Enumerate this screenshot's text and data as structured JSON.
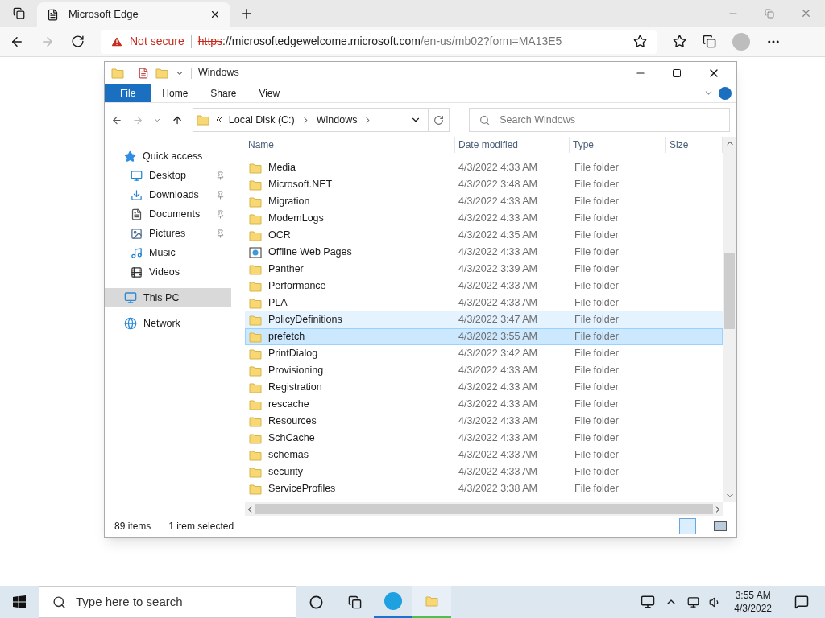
{
  "browser": {
    "tab_title": "Microsoft Edge",
    "security": "Not secure",
    "url_scheme": "https",
    "url_host": "://microsoftedgewelcome.microsoft.com",
    "url_path": "/en-us/mb02?form=MA13E5"
  },
  "explorer": {
    "title": "Windows",
    "ribbon_tabs": [
      {
        "label": "File",
        "kind": "file"
      },
      {
        "label": "Home",
        "kind": "tab"
      },
      {
        "label": "Share",
        "kind": "tab"
      },
      {
        "label": "View",
        "kind": "tab"
      }
    ],
    "breadcrumb": [
      "Local Disk (C:)",
      "Windows"
    ],
    "search": {
      "placeholder": "Search Windows"
    },
    "nav": [
      {
        "label": "Quick access",
        "kind": "quick",
        "selected": false,
        "pinned": false,
        "children": [
          {
            "label": "Desktop",
            "kind": "desktop",
            "selected": false,
            "pinned": true
          },
          {
            "label": "Downloads",
            "kind": "downloads",
            "selected": false,
            "pinned": true
          },
          {
            "label": "Documents",
            "kind": "documents",
            "selected": false,
            "pinned": true
          },
          {
            "label": "Pictures",
            "kind": "pictures",
            "selected": false,
            "pinned": true
          },
          {
            "label": "Music",
            "kind": "music",
            "selected": false,
            "pinned": false
          },
          {
            "label": "Videos",
            "kind": "videos",
            "selected": false,
            "pinned": false
          }
        ]
      },
      {
        "label": "This PC",
        "kind": "pc",
        "selected": true,
        "pinned": false
      },
      {
        "label": "Network",
        "kind": "network",
        "selected": false,
        "pinned": false
      }
    ],
    "columns": [
      "Name",
      "Date modified",
      "Type",
      "Size"
    ],
    "rows": [
      {
        "name": "Media",
        "date": "4/3/2022 4:33 AM",
        "type": "File folder",
        "kind": "folder",
        "selected": false,
        "hovered": false
      },
      {
        "name": "Microsoft.NET",
        "date": "4/3/2022 3:48 AM",
        "type": "File folder",
        "kind": "folder",
        "selected": false,
        "hovered": false
      },
      {
        "name": "Migration",
        "date": "4/3/2022 4:33 AM",
        "type": "File folder",
        "kind": "folder",
        "selected": false,
        "hovered": false
      },
      {
        "name": "ModemLogs",
        "date": "4/3/2022 4:33 AM",
        "type": "File folder",
        "kind": "folder",
        "selected": false,
        "hovered": false
      },
      {
        "name": "OCR",
        "date": "4/3/2022 4:35 AM",
        "type": "File folder",
        "kind": "folder",
        "selected": false,
        "hovered": false
      },
      {
        "name": "Offline Web Pages",
        "date": "4/3/2022 4:33 AM",
        "type": "File folder",
        "kind": "web",
        "selected": false,
        "hovered": false
      },
      {
        "name": "Panther",
        "date": "4/3/2022 3:39 AM",
        "type": "File folder",
        "kind": "folder",
        "selected": false,
        "hovered": false
      },
      {
        "name": "Performance",
        "date": "4/3/2022 4:33 AM",
        "type": "File folder",
        "kind": "folder",
        "selected": false,
        "hovered": false
      },
      {
        "name": "PLA",
        "date": "4/3/2022 4:33 AM",
        "type": "File folder",
        "kind": "folder",
        "selected": false,
        "hovered": false
      },
      {
        "name": "PolicyDefinitions",
        "date": "4/3/2022 3:47 AM",
        "type": "File folder",
        "kind": "folder",
        "selected": false,
        "hovered": true
      },
      {
        "name": "prefetch",
        "date": "4/3/2022 3:55 AM",
        "type": "File folder",
        "kind": "folder",
        "selected": true,
        "hovered": false
      },
      {
        "name": "PrintDialog",
        "date": "4/3/2022 3:42 AM",
        "type": "File folder",
        "kind": "folder",
        "selected": false,
        "hovered": false
      },
      {
        "name": "Provisioning",
        "date": "4/3/2022 4:33 AM",
        "type": "File folder",
        "kind": "folder",
        "selected": false,
        "hovered": false
      },
      {
        "name": "Registration",
        "date": "4/3/2022 4:33 AM",
        "type": "File folder",
        "kind": "folder",
        "selected": false,
        "hovered": false
      },
      {
        "name": "rescache",
        "date": "4/3/2022 4:33 AM",
        "type": "File folder",
        "kind": "folder",
        "selected": false,
        "hovered": false
      },
      {
        "name": "Resources",
        "date": "4/3/2022 4:33 AM",
        "type": "File folder",
        "kind": "folder",
        "selected": false,
        "hovered": false
      },
      {
        "name": "SchCache",
        "date": "4/3/2022 4:33 AM",
        "type": "File folder",
        "kind": "folder",
        "selected": false,
        "hovered": false
      },
      {
        "name": "schemas",
        "date": "4/3/2022 4:33 AM",
        "type": "File folder",
        "kind": "folder",
        "selected": false,
        "hovered": false
      },
      {
        "name": "security",
        "date": "4/3/2022 4:33 AM",
        "type": "File folder",
        "kind": "folder",
        "selected": false,
        "hovered": false
      },
      {
        "name": "ServiceProfiles",
        "date": "4/3/2022 3:38 AM",
        "type": "File folder",
        "kind": "folder",
        "selected": false,
        "hovered": false
      }
    ],
    "status": {
      "count": "89 items",
      "selection": "1 item selected"
    }
  },
  "taskbar": {
    "search_placeholder": "Type here to search",
    "time": "3:55 AM",
    "date": "4/3/2022"
  }
}
